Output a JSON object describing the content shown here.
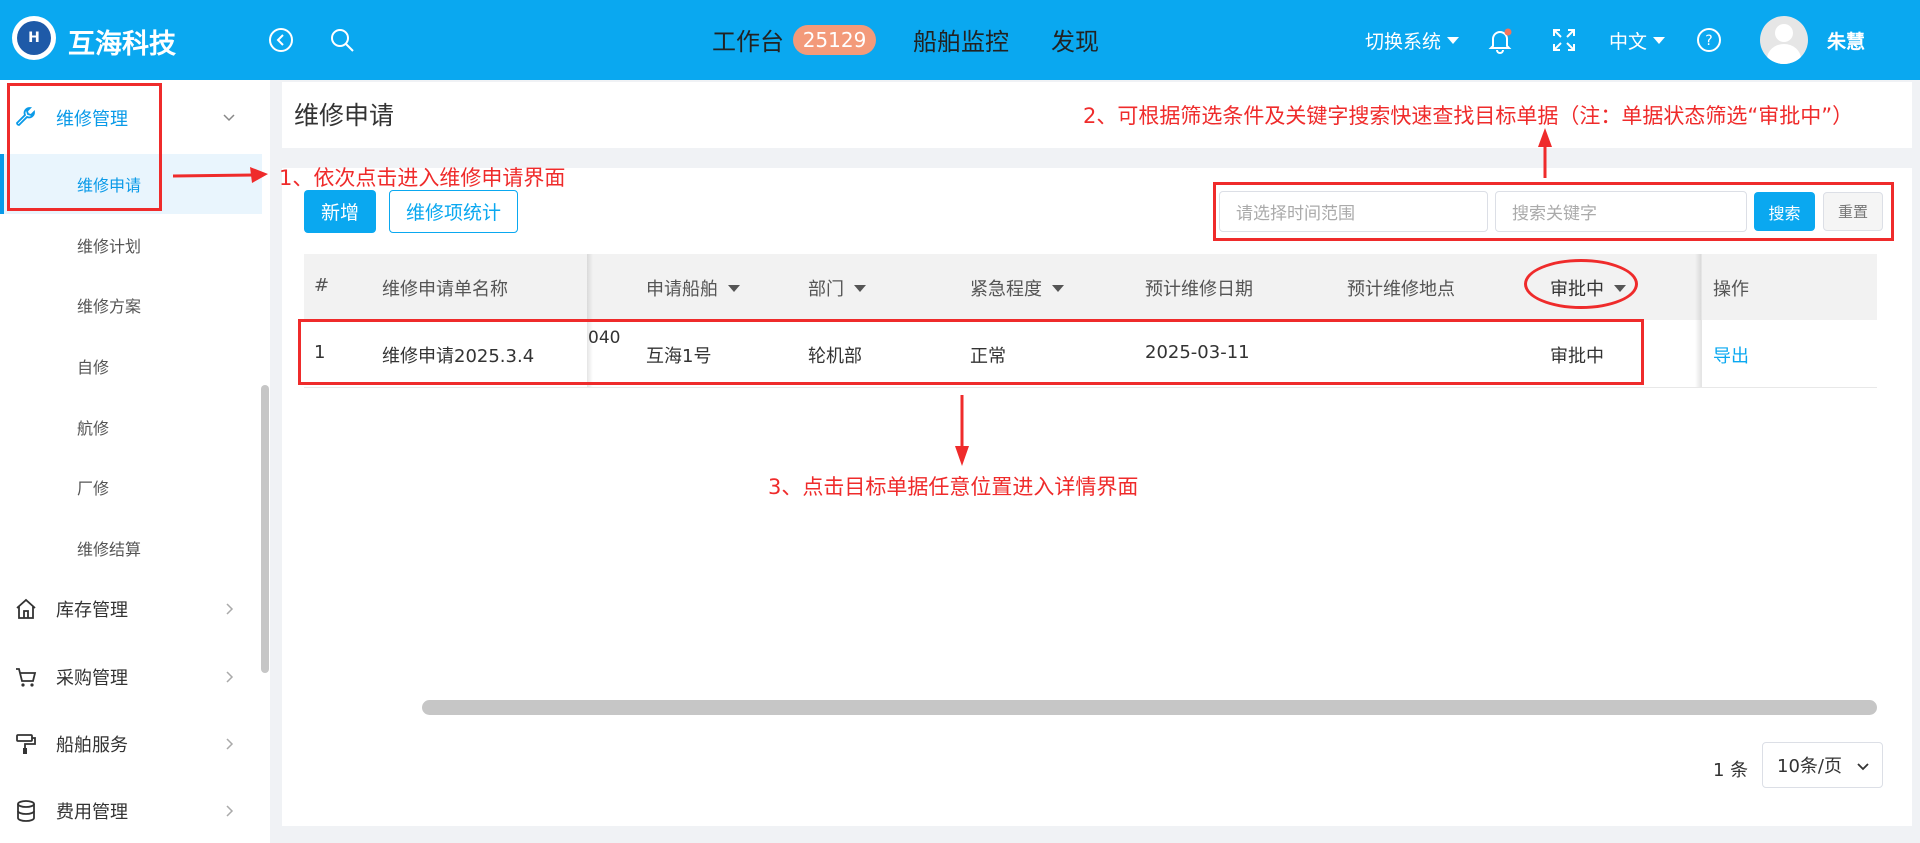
{
  "header": {
    "brand": "互海科技",
    "nav": [
      {
        "label": "工作台",
        "badge": "25129"
      },
      {
        "label": "船舶监控"
      },
      {
        "label": "发现"
      }
    ],
    "switch_system": "切换系统",
    "language": "中文",
    "username": "朱慧"
  },
  "sidebar": {
    "parent_active": "维修管理",
    "sub_items": [
      "维修申请",
      "维修计划",
      "维修方案",
      "自修",
      "航修",
      "厂修",
      "维修结算"
    ],
    "groups": [
      "库存管理",
      "采购管理",
      "船舶服务",
      "费用管理"
    ]
  },
  "page": {
    "title": "维修申请",
    "add_button": "新增",
    "stats_button": "维修项统计",
    "time_placeholder": "请选择时间范围",
    "keyword_placeholder": "搜索关键字",
    "search_button": "搜索",
    "reset_button": "重置"
  },
  "table": {
    "headers": {
      "index": "#",
      "name": "维修申请单名称",
      "ship": "申请船舶",
      "dept": "部门",
      "urgency": "紧急程度",
      "date": "预计维修日期",
      "location": "预计维修地点",
      "status": "审批中",
      "action": "操作"
    },
    "rows": [
      {
        "index": "1",
        "name": "维修申请2025.3.4",
        "partial": "040",
        "ship": "互海1号",
        "dept": "轮机部",
        "urgency": "正常",
        "date": "2025-03-11",
        "location": "",
        "status": "审批中",
        "action": "导出"
      }
    ]
  },
  "pagination": {
    "total": "1 条",
    "page_size": "10条/页"
  },
  "annotations": {
    "step1": "1、依次点击进入维修申请界面",
    "step2": "2、可根据筛选条件及关键字搜索快速查找目标单据（注：单据状态筛选“审批中”）",
    "step3": "3、点击目标单据任意位置进入详情界面"
  },
  "colors": {
    "primary": "#0aa8f0",
    "annotation": "#ef2b2b",
    "badge": "#f39a7a"
  }
}
